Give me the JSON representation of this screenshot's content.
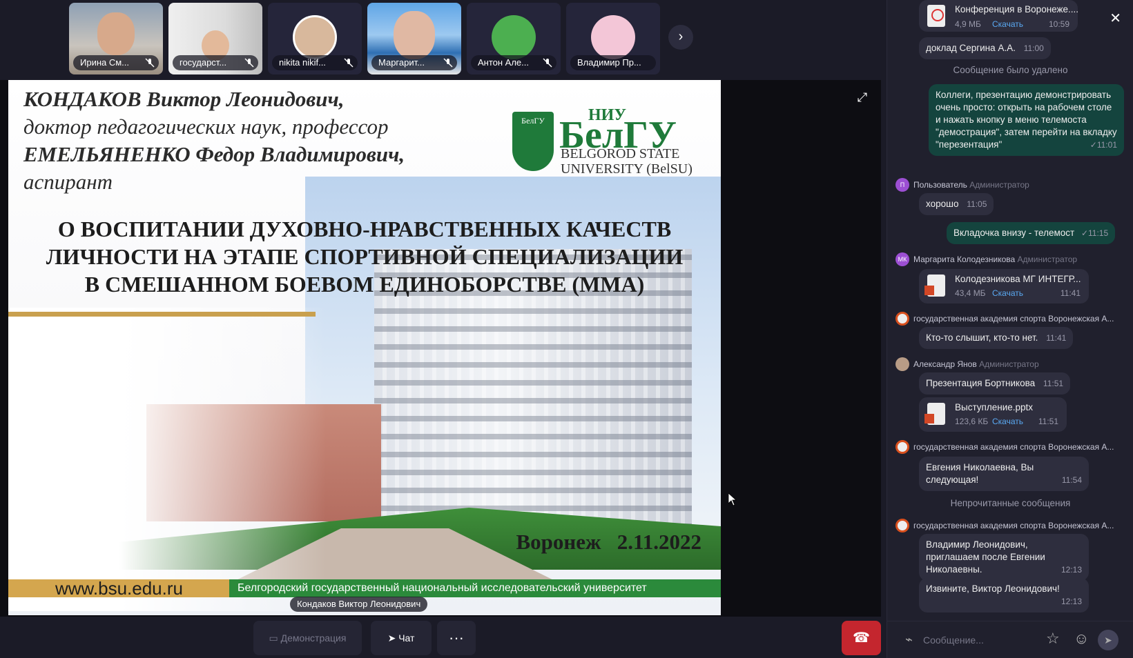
{
  "participants": [
    {
      "name": "Ирина См...",
      "muted": true
    },
    {
      "name": "государст...",
      "muted": true
    },
    {
      "name": "nikita nikif...",
      "muted": true
    },
    {
      "name": "Маргарит...",
      "muted": true
    },
    {
      "name": "Антон Але...",
      "muted": true
    },
    {
      "name": "Владимир Пр...",
      "muted": false
    }
  ],
  "strip_next_icon": "›",
  "slide": {
    "author1_name": "КОНДАКОВ Виктор Леонидович,",
    "author1_title": "доктор педагогических наук, профессор",
    "author2_name": "ЕМЕЛЬЯНЕНКО Федор Владимирович,",
    "author2_title": "аспирант",
    "logo_shield": "БелГУ",
    "logo_niu": "НИУ",
    "logo_main": "БелГУ",
    "logo_en_1": "BELGOROD STATE",
    "logo_en_2": "UNIVERSITY (BelSU)",
    "title_1": "О ВОСПИТАНИИ ДУХОВНО-НРАВСТВЕННЫХ КАЧЕСТВ",
    "title_2": "ЛИЧНОСТИ НА ЭТАПЕ СПОРТИВНОЙ СПЕЦИАЛИЗАЦИИ",
    "title_3": "В СМЕШАННОМ БОЕВОМ ЕДИНОБОРСТВЕ (ММА)",
    "date": "Воронеж   2.11.2022",
    "url": "www.bsu.edu.ru",
    "footer": "Белгородский государственный национальный исследовательский университет"
  },
  "speaker": "Кондаков Виктор Леонидович",
  "toolbar": {
    "demo": "Демонстрация",
    "chat": "Чат",
    "more": "···"
  },
  "chat": {
    "file1": {
      "name": "Конференция в Воронеже....",
      "size": "4,9 МБ",
      "download": "Скачать",
      "time": "10:59"
    },
    "msg1": {
      "text": "доклад Сергина А.А.",
      "time": "11:00"
    },
    "sys_deleted": "Сообщение было удалено",
    "out1": {
      "text": "Коллеги, презентацию демонстрировать очень просто: открыть на рабочем столе и нажать кнопку в меню телемоста \"демострация\", затем перейти на вкладку \"перезентация\"",
      "time": "✓11:01"
    },
    "u1": {
      "initials": "П",
      "name": "Пользователь",
      "role": "Администратор"
    },
    "msg2": {
      "text": "хорошо",
      "time": "11:05"
    },
    "out2": {
      "text": "Вкладочка внизу - телемост",
      "time": "✓11:15"
    },
    "u2": {
      "initials": "МК",
      "name": "Маргарита Колодезникова",
      "role": "Администратор"
    },
    "file2": {
      "name": "Колодезникова МГ ИНТЕГР...",
      "size": "43,4 МБ",
      "download": "Скачать",
      "time": "11:41"
    },
    "u3": {
      "name": "государственная академия спорта Воронежская А..."
    },
    "msg3": {
      "text": "Кто-то слышит, кто-то нет.",
      "time": "11:41"
    },
    "u4": {
      "name": "Александр Янов",
      "role": "Администратор"
    },
    "msg4": {
      "text": "Презентация Бортникова",
      "time": "11:51"
    },
    "file3": {
      "name": "Выступление.pptx",
      "size": "123,6 КБ",
      "download": "Скачать",
      "time": "11:51"
    },
    "u5": {
      "name": "государственная академия спорта Воронежская А..."
    },
    "msg5": {
      "text": "Евгения Николаевна, Вы следующая!",
      "time": "11:54"
    },
    "sys_unread": "Непрочитанные сообщения",
    "u6": {
      "name": "государственная академия спорта Воронежская А..."
    },
    "msg6": {
      "text": "Владимир Леонидович, приглашаем после Евгении Николаевны.",
      "time": "12:13"
    },
    "msg7": {
      "text": "Извините, Виктор Леонидович!",
      "time": "12:13"
    },
    "composer_placeholder": "Сообщение..."
  },
  "colors": {
    "accent_green": "#14443e",
    "hangup": "#c4262e",
    "link": "#5aa9f2"
  }
}
